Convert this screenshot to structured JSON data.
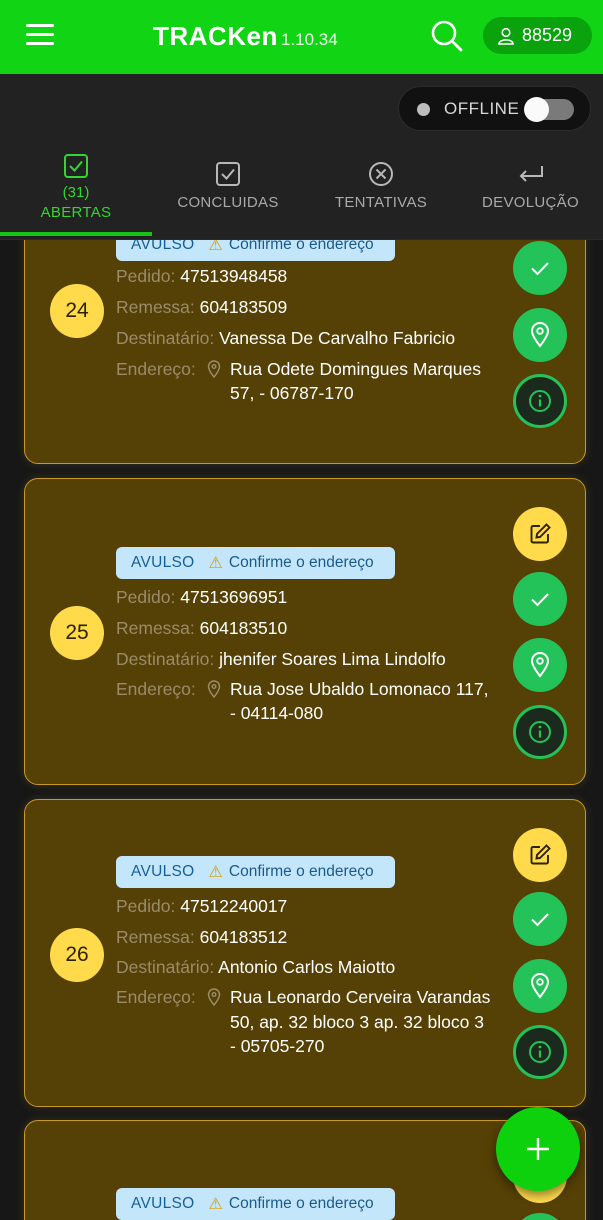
{
  "header": {
    "brand": "TRACKen",
    "version": "1.10.34",
    "user_code": "88529",
    "icons": {
      "menu": "hamburger-menu-icon",
      "search": "search-icon",
      "user": "user-icon"
    },
    "colors": {
      "header_bg": "#11d414",
      "accent": "#23c35a"
    }
  },
  "status": {
    "label": "OFFLINE",
    "toggle_on": false
  },
  "tabs": [
    {
      "count": "(31)",
      "label": "ABERTAS",
      "active": true,
      "icon": "checkbox-icon"
    },
    {
      "label": "CONCLUIDAS",
      "active": false,
      "icon": "checkbox-icon"
    },
    {
      "label": "TENTATIVAS",
      "active": false,
      "icon": "x-circle-icon"
    },
    {
      "label": "DEVOLUÇÃO",
      "active": false,
      "icon": "return-arrow-icon"
    }
  ],
  "labels": {
    "pedido": "Pedido:",
    "remessa": "Remessa:",
    "destinatario": "Destinatário:",
    "endereco": "Endereço:",
    "avulso": "AVULSO",
    "confirm": "Confirme o endereço"
  },
  "cards": [
    {
      "number": "24",
      "pedido": "47513948458",
      "remessa": "604183509",
      "destinatario": "Vanessa De Carvalho Fabricio",
      "endereco_lines": [
        "Rua Odete Domingues Marques",
        "57, - 06787-170"
      ]
    },
    {
      "number": "25",
      "pedido": "47513696951",
      "remessa": "604183510",
      "destinatario": "jhenifer Soares Lima Lindolfo",
      "endereco_lines": [
        "Rua Jose Ubaldo Lomonaco 117,",
        "- 04114-080"
      ]
    },
    {
      "number": "26",
      "pedido": "47512240017",
      "remessa": "604183512",
      "destinatario": "Antonio Carlos Maiotto",
      "endereco_lines": [
        "Rua Leonardo Cerveira Varandas",
        "50, ap. 32 bloco 3 ap. 32 bloco 3",
        "- 05705-270"
      ]
    }
  ]
}
